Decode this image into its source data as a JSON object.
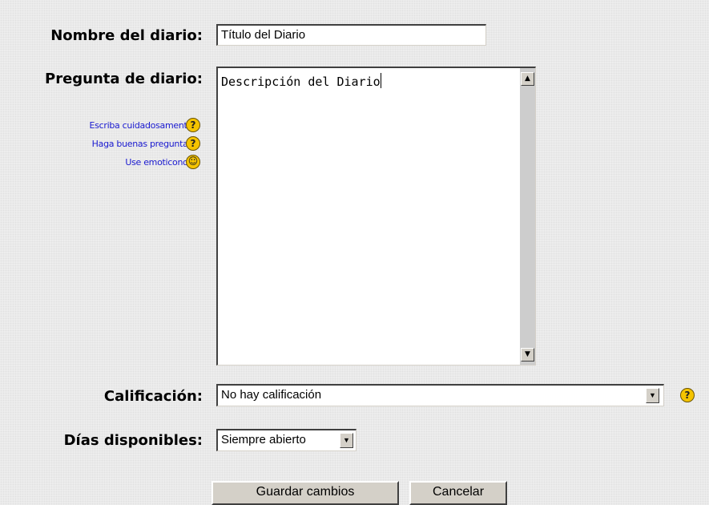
{
  "form": {
    "name": {
      "label": "Nombre del diario:",
      "value": "Título del Diario"
    },
    "question": {
      "label": "Pregunta de diario:",
      "value": "Descripción del Diario",
      "help_links": [
        "Escriba cuidadosamente",
        "Haga buenas preguntas",
        "Use emoticonos"
      ]
    },
    "grading": {
      "label": "Calificación:",
      "selected": "No hay calificación"
    },
    "days": {
      "label": "Días disponibles:",
      "selected": "Siempre abierto"
    },
    "buttons": {
      "save": "Guardar cambios",
      "cancel": "Cancelar"
    }
  },
  "icons": {
    "help": "help-icon",
    "emoticon": "smiley-icon",
    "dropdown": "dropdown-arrow-icon",
    "scroll_up": "scroll-up-arrow-icon",
    "scroll_down": "scroll-down-arrow-icon"
  },
  "colors": {
    "link": "#1a1ad0",
    "help_icon": "#f5c400",
    "background": "#ededed"
  }
}
